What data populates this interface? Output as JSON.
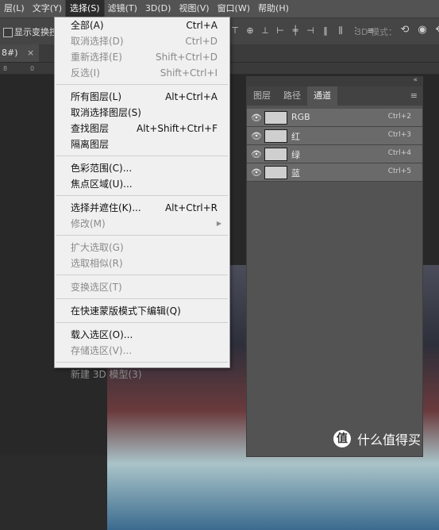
{
  "menubar": {
    "items": [
      {
        "label": "层(L)",
        "active": false
      },
      {
        "label": "文字(Y)",
        "active": false
      },
      {
        "label": "选择(S)",
        "active": true
      },
      {
        "label": "滤镜(T)",
        "active": false
      },
      {
        "label": "3D(D)",
        "active": false
      },
      {
        "label": "视图(V)",
        "active": false
      },
      {
        "label": "窗口(W)",
        "active": false
      },
      {
        "label": "帮助(H)",
        "active": false
      }
    ]
  },
  "optionsbar": {
    "show_transform_label": "显示变换控",
    "mode_3d_label": "3D 模式："
  },
  "document": {
    "tab_label": "8#)",
    "close_glyph": "×",
    "ruler_ticks": [
      "8",
      "0"
    ]
  },
  "select_menu": {
    "items": [
      {
        "label": "全部(A)",
        "shortcut": "Ctrl+A",
        "disabled": false
      },
      {
        "label": "取消选择(D)",
        "shortcut": "Ctrl+D",
        "disabled": true
      },
      {
        "label": "重新选择(E)",
        "shortcut": "Shift+Ctrl+D",
        "disabled": true
      },
      {
        "label": "反选(I)",
        "shortcut": "Shift+Ctrl+I",
        "disabled": true
      },
      {
        "sep": true
      },
      {
        "label": "所有图层(L)",
        "shortcut": "Alt+Ctrl+A",
        "disabled": false
      },
      {
        "label": "取消选择图层(S)",
        "shortcut": "",
        "disabled": false
      },
      {
        "label": "查找图层",
        "shortcut": "Alt+Shift+Ctrl+F",
        "disabled": false
      },
      {
        "label": "隔离图层",
        "shortcut": "",
        "disabled": false
      },
      {
        "sep": true
      },
      {
        "label": "色彩范围(C)...",
        "shortcut": "",
        "disabled": false
      },
      {
        "label": "焦点区域(U)...",
        "shortcut": "",
        "disabled": false
      },
      {
        "sep": true
      },
      {
        "label": "选择并遮住(K)...",
        "shortcut": "Alt+Ctrl+R",
        "disabled": false
      },
      {
        "label": "修改(M)",
        "shortcut": "",
        "disabled": true,
        "submenu": true
      },
      {
        "sep": true
      },
      {
        "label": "扩大选取(G)",
        "shortcut": "",
        "disabled": true
      },
      {
        "label": "选取相似(R)",
        "shortcut": "",
        "disabled": true
      },
      {
        "sep": true
      },
      {
        "label": "变换选区(T)",
        "shortcut": "",
        "disabled": true
      },
      {
        "sep": true
      },
      {
        "label": "在快速蒙版模式下编辑(Q)",
        "shortcut": "",
        "disabled": false
      },
      {
        "sep": true
      },
      {
        "label": "载入选区(O)...",
        "shortcut": "",
        "disabled": false
      },
      {
        "label": "存储选区(V)...",
        "shortcut": "",
        "disabled": true
      },
      {
        "sep": true
      },
      {
        "label": "新建 3D 模型(3)",
        "shortcut": "",
        "disabled": true
      }
    ]
  },
  "panel": {
    "tabs": [
      {
        "label": "图层",
        "active": false
      },
      {
        "label": "路径",
        "active": false
      },
      {
        "label": "通道",
        "active": true
      }
    ],
    "collapse_glyph": "«",
    "channels": [
      {
        "name": "RGB",
        "shortcut": "Ctrl+2"
      },
      {
        "name": "红",
        "shortcut": "Ctrl+3"
      },
      {
        "name": "绿",
        "shortcut": "Ctrl+4"
      },
      {
        "name": "蓝",
        "shortcut": "Ctrl+5"
      }
    ]
  },
  "watermark": {
    "badge": "值",
    "text": "什么值得买"
  }
}
